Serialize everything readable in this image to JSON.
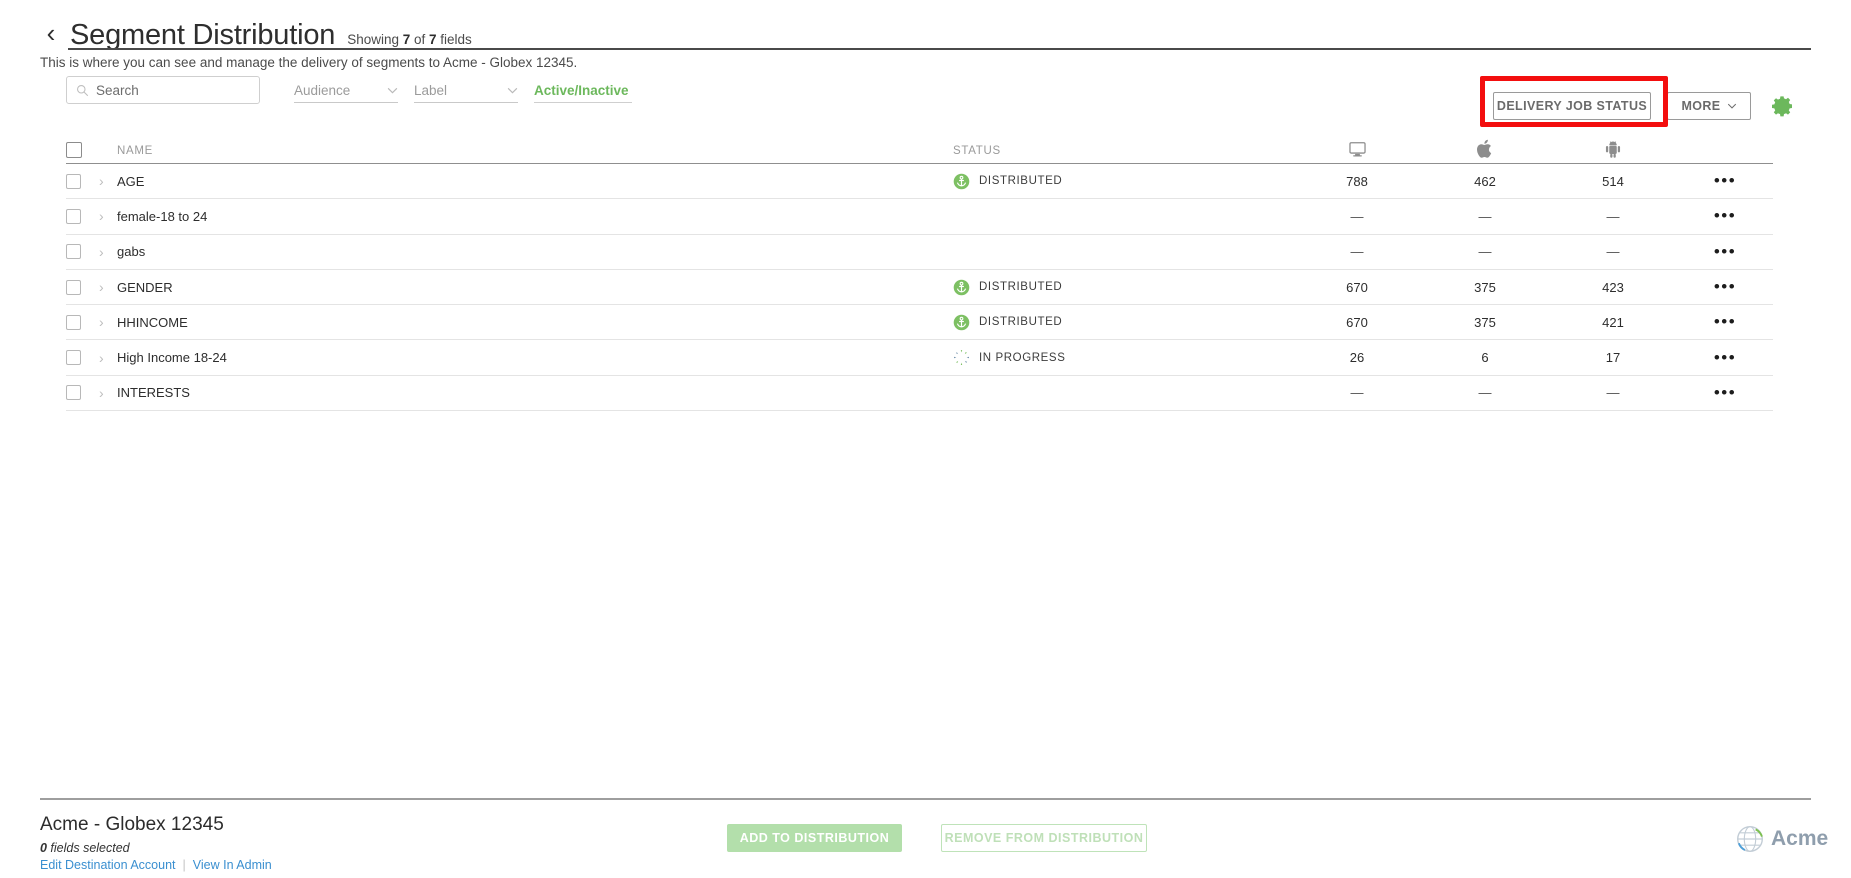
{
  "header": {
    "back_icon": "chevron-left-icon",
    "title": "Segment Distribution",
    "showing_prefix": "Showing ",
    "showing_count": "7",
    "showing_mid": " of ",
    "showing_total": "7",
    "showing_suffix": " fields",
    "subtitle": "This is where you can see and manage the delivery of segments to Acme - Globex 12345."
  },
  "toolbar": {
    "search_placeholder": "Search",
    "search_value": "",
    "search_icon": "search-icon",
    "filters": [
      {
        "label": "Audience",
        "active": false,
        "icon": "chevron-down-icon"
      },
      {
        "label": "Label",
        "active": false,
        "icon": "chevron-down-icon"
      },
      {
        "label": "Active/Inactive",
        "active": true,
        "icon": "chevron-down-icon"
      }
    ],
    "delivery_job_status_label": "DELIVERY JOB STATUS",
    "more_label": "MORE",
    "more_icon": "chevron-down-icon",
    "settings_icon": "gear-icon",
    "highlight_color": "#f30e0e",
    "accent_green": "#6cb85c"
  },
  "table": {
    "headers": {
      "select_all": "select-all-checkbox",
      "name": "NAME",
      "status": "STATUS",
      "device_columns": [
        {
          "icon": "desktop-icon"
        },
        {
          "icon": "apple-icon"
        },
        {
          "icon": "android-icon"
        }
      ]
    },
    "rows": [
      {
        "name": "AGE",
        "status": "DISTRIBUTED",
        "status_icon": "anchor-distributed-icon",
        "desktop": "788",
        "apple": "462",
        "android": "514",
        "menu_icon": "ellipsis-icon"
      },
      {
        "name": "female-18 to 24",
        "status": "",
        "status_icon": "",
        "desktop": "—",
        "apple": "—",
        "android": "—",
        "menu_icon": "ellipsis-icon"
      },
      {
        "name": "gabs",
        "status": "",
        "status_icon": "",
        "desktop": "—",
        "apple": "—",
        "android": "—",
        "menu_icon": "ellipsis-icon"
      },
      {
        "name": "GENDER",
        "status": "DISTRIBUTED",
        "status_icon": "anchor-distributed-icon",
        "desktop": "670",
        "apple": "375",
        "android": "423",
        "menu_icon": "ellipsis-icon"
      },
      {
        "name": "HHINCOME",
        "status": "DISTRIBUTED",
        "status_icon": "anchor-distributed-icon",
        "desktop": "670",
        "apple": "375",
        "android": "421",
        "menu_icon": "ellipsis-icon"
      },
      {
        "name": "High Income 18-24",
        "status": "IN PROGRESS",
        "status_icon": "spinner-in-progress-icon",
        "desktop": "26",
        "apple": "6",
        "android": "17",
        "menu_icon": "ellipsis-icon"
      },
      {
        "name": "INTERESTS",
        "status": "",
        "status_icon": "",
        "desktop": "—",
        "apple": "—",
        "android": "—",
        "menu_icon": "ellipsis-icon"
      }
    ]
  },
  "footer": {
    "account_name": "Acme - Globex 12345",
    "selected_count": "0",
    "selected_label": " fields selected",
    "edit_account_link": "Edit Destination Account",
    "view_admin_link": "View In Admin",
    "add_button": "ADD TO DISTRIBUTION",
    "remove_button": "REMOVE FROM DISTRIBUTION",
    "brand_name": "Acme",
    "brand_icon": "globe-icon"
  }
}
